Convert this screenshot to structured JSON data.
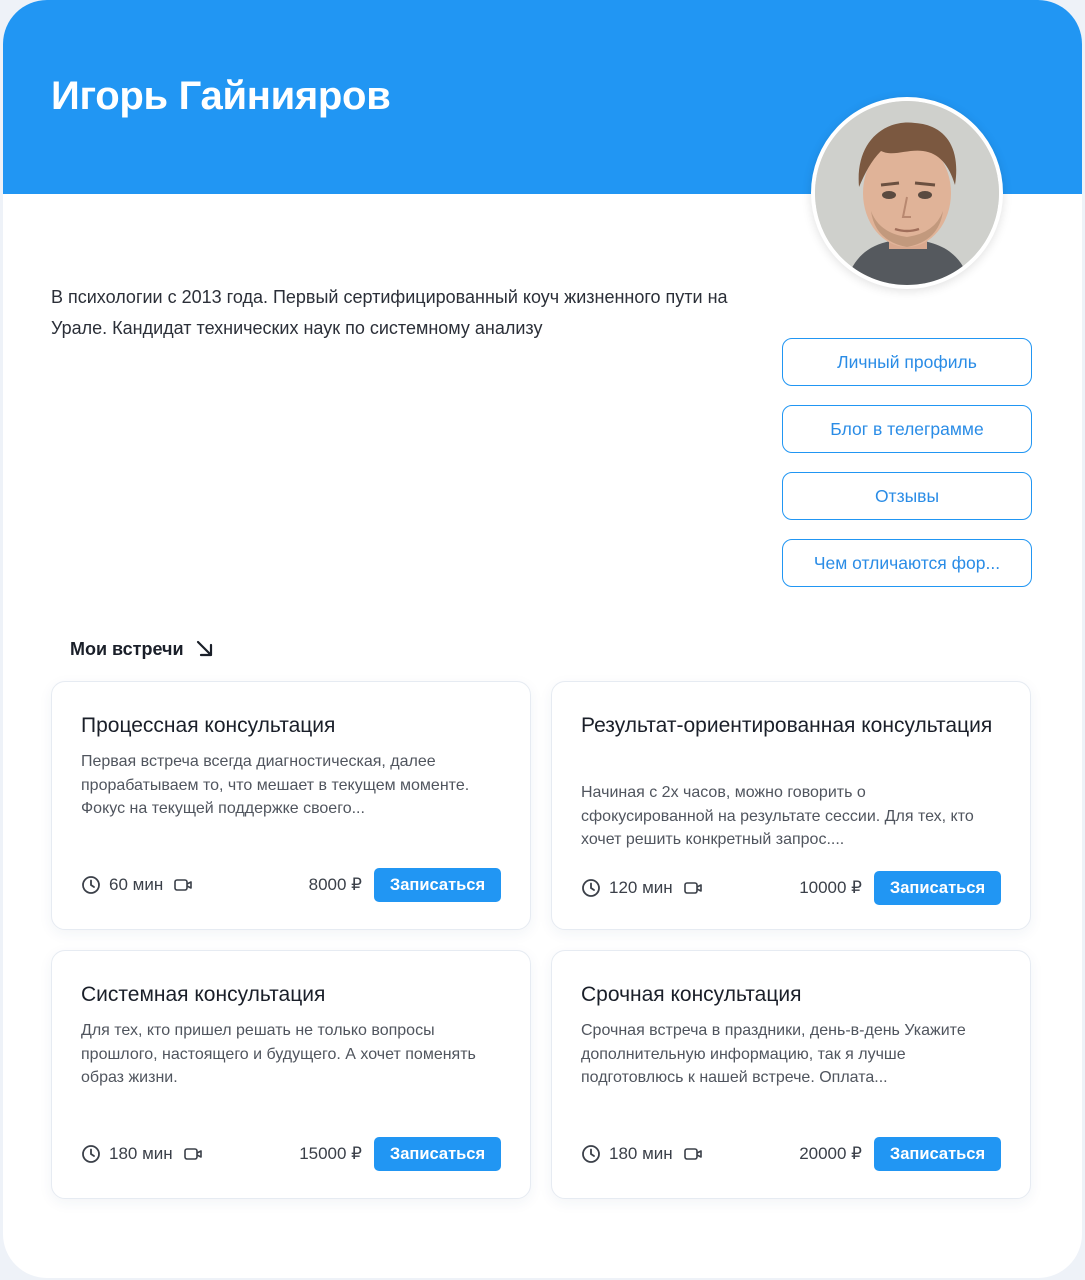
{
  "profile": {
    "name": "Игорь Гайнияров",
    "bio": "В психологии с 2013 года. Первый сертифицированный коуч жизненного пути на Урале. Кандидат технических наук по системному анализу"
  },
  "links": [
    {
      "label": "Личный профиль"
    },
    {
      "label": "Блог в телеграмме"
    },
    {
      "label": "Отзывы"
    },
    {
      "label": "Чем отличаются фор..."
    }
  ],
  "meetings": {
    "title": "Мои встречи",
    "items": [
      {
        "title": "Процессная консультация",
        "description": "Первая встреча всегда диагностическая, далее прорабатываем то, что мешает в текущем моменте. Фокус на текущей поддержке своего...",
        "duration": "60 мин",
        "price": "8000 ₽",
        "button": "Записаться"
      },
      {
        "title": "Результат-ориентированная консультация",
        "description": "Начиная с 2х часов, можно говорить о сфокусированной на результате сессии. Для тех, кто хочет решить конкретный запрос....",
        "duration": "120 мин",
        "price": "10000 ₽",
        "button": "Записаться"
      },
      {
        "title": "Системная консультация",
        "description": "Для тех, кто пришел решать не только вопросы прошлого, настоящего и будущего. А хочет поменять образ жизни.",
        "duration": "180 мин",
        "price": "15000 ₽",
        "button": "Записаться"
      },
      {
        "title": "Срочная консультация",
        "description": "Срочная встреча в праздники, день-в-день Укажите дополнительную информацию, так я лучше подготовлюсь к нашей встрече. Оплата...",
        "duration": "180 мин",
        "price": "20000 ₽",
        "button": "Записаться"
      }
    ]
  },
  "colors": {
    "accent": "#2196f3",
    "background": "#ffffff",
    "text": "#1f2633"
  },
  "icons": {
    "section": "arrow-down-right-icon",
    "duration": "clock-icon",
    "format": "video-camera-icon"
  }
}
